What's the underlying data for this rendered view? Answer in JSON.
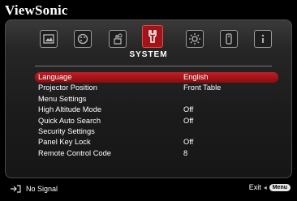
{
  "brand": "ViewSonic",
  "tabs": [
    {
      "icon": "picture-icon"
    },
    {
      "icon": "color-palette-icon"
    },
    {
      "icon": "hand-settings-icon"
    },
    {
      "icon": "wrench-icon",
      "label": "SYSTEM",
      "selected": true
    },
    {
      "icon": "gear-icon"
    },
    {
      "icon": "remote-icon"
    },
    {
      "icon": "info-icon"
    }
  ],
  "menu": [
    {
      "label": "Language",
      "value": "English",
      "active": true
    },
    {
      "label": "Projector Position",
      "value": "Front Table"
    },
    {
      "label": "Menu Settings",
      "value": ""
    },
    {
      "label": "High Altitude Mode",
      "value": "Off"
    },
    {
      "label": "Quick Auto Search",
      "value": "Off"
    },
    {
      "label": "Security Settings",
      "value": ""
    },
    {
      "label": "Panel Key Lock",
      "value": "Off"
    },
    {
      "label": "Remote Control Code",
      "value": "8"
    }
  ],
  "footer": {
    "source_text": "No Signal",
    "exit_text": "Exit",
    "menu_button_label": "Menu"
  },
  "colors": {
    "accent": "#b0181e",
    "selected_tab": "#a0141a"
  }
}
